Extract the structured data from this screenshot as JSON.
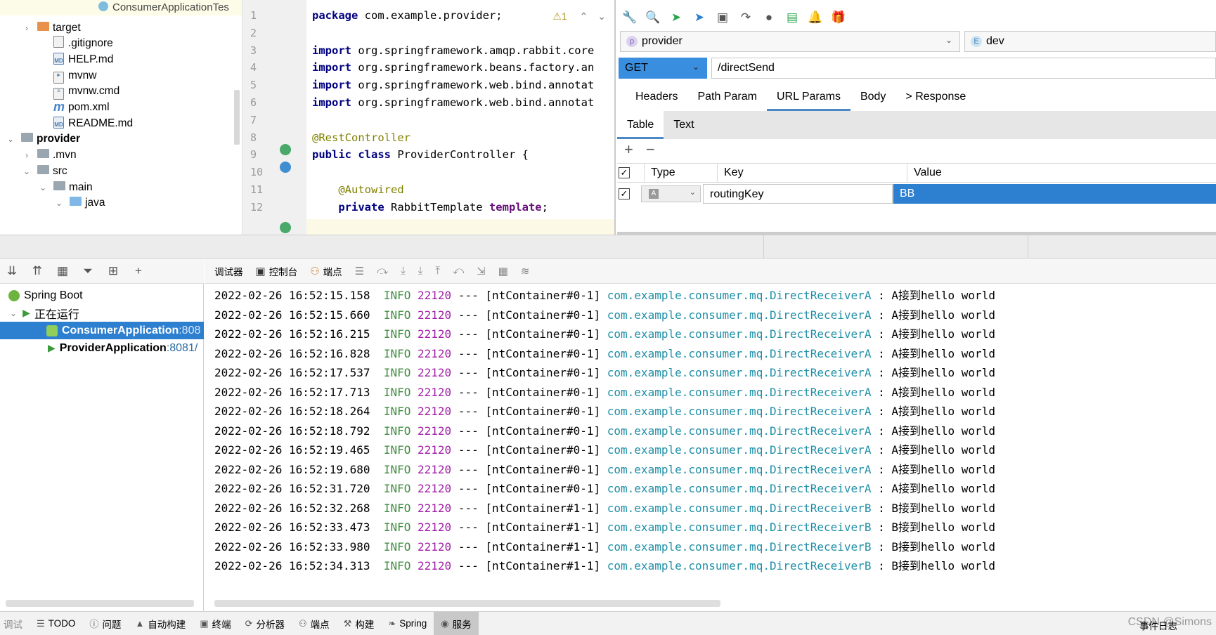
{
  "project": {
    "top_tab": "ConsumerApplicationTes",
    "items": [
      {
        "label": "target",
        "icon": "folder-orange-icon",
        "indent": 1,
        "arrow": "›",
        "bold": false
      },
      {
        "label": ".gitignore",
        "icon": "file-icon",
        "indent": 2,
        "arrow": "",
        "bold": false
      },
      {
        "label": "HELP.md",
        "icon": "markdown-icon",
        "indent": 2,
        "arrow": "",
        "bold": false
      },
      {
        "label": "mvnw",
        "icon": "script-icon",
        "indent": 2,
        "arrow": "",
        "bold": false
      },
      {
        "label": "mvnw.cmd",
        "icon": "text-file-icon",
        "indent": 2,
        "arrow": "",
        "bold": false
      },
      {
        "label": "pom.xml",
        "icon": "maven-icon",
        "indent": 2,
        "arrow": "",
        "bold": false
      },
      {
        "label": "README.md",
        "icon": "markdown-icon",
        "indent": 2,
        "arrow": "",
        "bold": false
      },
      {
        "label": "provider",
        "icon": "folder-icon",
        "indent": 0,
        "arrow": "⌄",
        "bold": true
      },
      {
        "label": ".mvn",
        "icon": "folder-icon",
        "indent": 1,
        "arrow": "›",
        "bold": false
      },
      {
        "label": "src",
        "icon": "folder-icon",
        "indent": 1,
        "arrow": "⌄",
        "bold": false
      },
      {
        "label": "main",
        "icon": "folder-icon",
        "indent": 2,
        "arrow": "⌄",
        "bold": false
      },
      {
        "label": "java",
        "icon": "folder-blue-icon",
        "indent": 3,
        "arrow": "⌄",
        "bold": false
      }
    ]
  },
  "editor": {
    "warning": "⚠1",
    "lines": [
      {
        "n": "1",
        "html": "<span class='kw'>package</span> com.example.provider;"
      },
      {
        "n": "2",
        "html": ""
      },
      {
        "n": "3",
        "html": "<span class='kw'>import</span> org.springframework.amqp.rabbit.core"
      },
      {
        "n": "4",
        "html": "<span class='kw'>import</span> org.springframework.beans.factory.an"
      },
      {
        "n": "5",
        "html": "<span class='kw'>import</span> org.springframework.web.bind.annotat"
      },
      {
        "n": "6",
        "html": "<span class='kw'>import</span> org.springframework.web.bind.annotat"
      },
      {
        "n": "7",
        "html": ""
      },
      {
        "n": "8",
        "html": "<span class='ann'>@RestController</span>"
      },
      {
        "n": "9",
        "html": "<span class='kw'>public class</span> ProviderController {"
      },
      {
        "n": "10",
        "html": ""
      },
      {
        "n": "11",
        "html": "    <span class='ann'>@Autowired</span>"
      },
      {
        "n": "12",
        "html": "    <span class='kw'>private</span> RabbitTemplate <span class='fld'>template</span>;"
      }
    ]
  },
  "rest": {
    "project": "provider",
    "project_badge": "p",
    "env": "dev",
    "env_badge": "E",
    "method": "GET",
    "url": "/directSend",
    "tabs": [
      "Headers",
      "Path Param",
      "URL Params",
      "Body",
      "> Response"
    ],
    "active_tab": "URL Params",
    "subtabs": [
      "Table",
      "Text"
    ],
    "columns": [
      "Type",
      "Key",
      "Value"
    ],
    "row": {
      "type_badge": "A",
      "key": "routingKey",
      "value": "BB"
    }
  },
  "services": {
    "root": "Spring Boot",
    "running": "正在运行",
    "apps": [
      {
        "name": "ConsumerApplication",
        "port": ":808",
        "selected": true
      },
      {
        "name": "ProviderApplication",
        "port": ":8081/",
        "selected": false
      }
    ]
  },
  "console_toolbar": {
    "debugger": "调试器",
    "console": "控制台",
    "breakpoints": "端点"
  },
  "console": {
    "lines": [
      {
        "ts": "2022-02-26 16:52:15.158",
        "level": "INFO",
        "pid": "22120",
        "sep": "---",
        "thread": "[ntContainer#0-1]",
        "cls": "com.example.consumer.mq.DirectReceiverA",
        "msg": ": A接到hello world"
      },
      {
        "ts": "2022-02-26 16:52:15.660",
        "level": "INFO",
        "pid": "22120",
        "sep": "---",
        "thread": "[ntContainer#0-1]",
        "cls": "com.example.consumer.mq.DirectReceiverA",
        "msg": ": A接到hello world"
      },
      {
        "ts": "2022-02-26 16:52:16.215",
        "level": "INFO",
        "pid": "22120",
        "sep": "---",
        "thread": "[ntContainer#0-1]",
        "cls": "com.example.consumer.mq.DirectReceiverA",
        "msg": ": A接到hello world"
      },
      {
        "ts": "2022-02-26 16:52:16.828",
        "level": "INFO",
        "pid": "22120",
        "sep": "---",
        "thread": "[ntContainer#0-1]",
        "cls": "com.example.consumer.mq.DirectReceiverA",
        "msg": ": A接到hello world"
      },
      {
        "ts": "2022-02-26 16:52:17.537",
        "level": "INFO",
        "pid": "22120",
        "sep": "---",
        "thread": "[ntContainer#0-1]",
        "cls": "com.example.consumer.mq.DirectReceiverA",
        "msg": ": A接到hello world"
      },
      {
        "ts": "2022-02-26 16:52:17.713",
        "level": "INFO",
        "pid": "22120",
        "sep": "---",
        "thread": "[ntContainer#0-1]",
        "cls": "com.example.consumer.mq.DirectReceiverA",
        "msg": ": A接到hello world"
      },
      {
        "ts": "2022-02-26 16:52:18.264",
        "level": "INFO",
        "pid": "22120",
        "sep": "---",
        "thread": "[ntContainer#0-1]",
        "cls": "com.example.consumer.mq.DirectReceiverA",
        "msg": ": A接到hello world"
      },
      {
        "ts": "2022-02-26 16:52:18.792",
        "level": "INFO",
        "pid": "22120",
        "sep": "---",
        "thread": "[ntContainer#0-1]",
        "cls": "com.example.consumer.mq.DirectReceiverA",
        "msg": ": A接到hello world"
      },
      {
        "ts": "2022-02-26 16:52:19.465",
        "level": "INFO",
        "pid": "22120",
        "sep": "---",
        "thread": "[ntContainer#0-1]",
        "cls": "com.example.consumer.mq.DirectReceiverA",
        "msg": ": A接到hello world"
      },
      {
        "ts": "2022-02-26 16:52:19.680",
        "level": "INFO",
        "pid": "22120",
        "sep": "---",
        "thread": "[ntContainer#0-1]",
        "cls": "com.example.consumer.mq.DirectReceiverA",
        "msg": ": A接到hello world"
      },
      {
        "ts": "2022-02-26 16:52:31.720",
        "level": "INFO",
        "pid": "22120",
        "sep": "---",
        "thread": "[ntContainer#0-1]",
        "cls": "com.example.consumer.mq.DirectReceiverA",
        "msg": ": A接到hello world"
      },
      {
        "ts": "2022-02-26 16:52:32.268",
        "level": "INFO",
        "pid": "22120",
        "sep": "---",
        "thread": "[ntContainer#1-1]",
        "cls": "com.example.consumer.mq.DirectReceiverB",
        "msg": ": B接到hello world"
      },
      {
        "ts": "2022-02-26 16:52:33.473",
        "level": "INFO",
        "pid": "22120",
        "sep": "---",
        "thread": "[ntContainer#1-1]",
        "cls": "com.example.consumer.mq.DirectReceiverB",
        "msg": ": B接到hello world"
      },
      {
        "ts": "2022-02-26 16:52:33.980",
        "level": "INFO",
        "pid": "22120",
        "sep": "---",
        "thread": "[ntContainer#1-1]",
        "cls": "com.example.consumer.mq.DirectReceiverB",
        "msg": ": B接到hello world"
      },
      {
        "ts": "2022-02-26 16:52:34.313",
        "level": "INFO",
        "pid": "22120",
        "sep": "---",
        "thread": "[ntContainer#1-1]",
        "cls": "com.example.consumer.mq.DirectReceiverB",
        "msg": ": B接到hello world"
      }
    ]
  },
  "bottombar": {
    "items": [
      {
        "label": "调试",
        "icon": "debug-icon"
      },
      {
        "label": "TODO",
        "icon": "list-icon"
      },
      {
        "label": "问题",
        "icon": "info-icon"
      },
      {
        "label": "自动构建",
        "icon": "warning-icon"
      },
      {
        "label": "终端",
        "icon": "terminal-icon"
      },
      {
        "label": "分析器",
        "icon": "profiler-icon"
      },
      {
        "label": "端点",
        "icon": "endpoints-icon"
      },
      {
        "label": "构建",
        "icon": "hammer-icon"
      },
      {
        "label": "Spring",
        "icon": "spring-icon"
      },
      {
        "label": "服务",
        "icon": "services-icon"
      }
    ],
    "active": "服务",
    "event_log": "事件日志",
    "watermark": "CSDN @Simons"
  },
  "colors": {
    "accent": "#2d7fcf",
    "log_level": "#3f8c3f",
    "log_pid": "#a21ea8",
    "log_class": "#1f8fa6"
  }
}
